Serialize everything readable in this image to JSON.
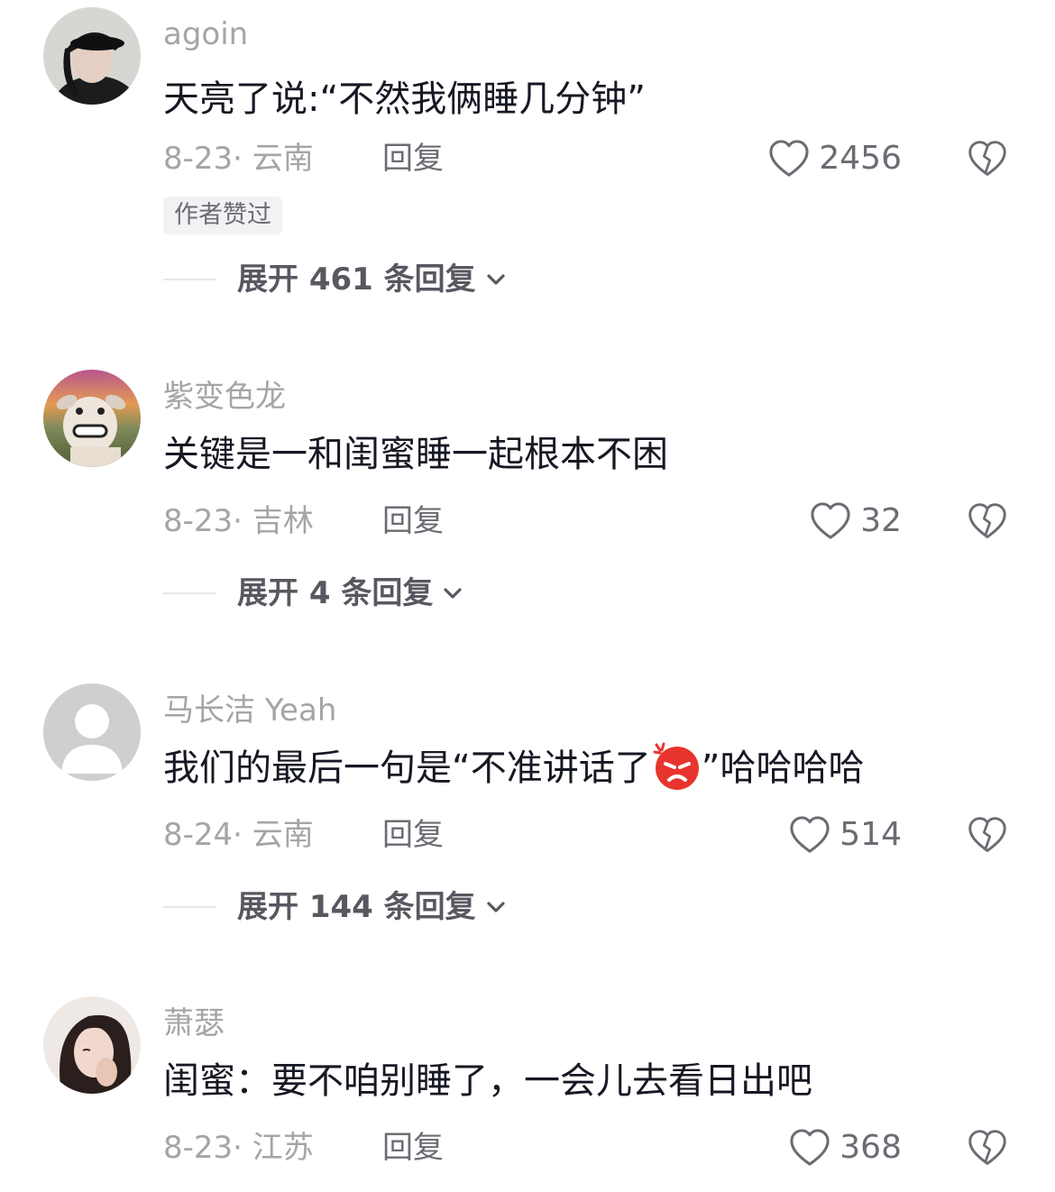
{
  "comments": [
    {
      "username": "agoin",
      "text": "天亮了说:“不然我俩睡几分钟”",
      "meta": "8-23· 云南",
      "reply": "回复",
      "likes": "2456",
      "badge": "作者赞过",
      "expand": "展开 461 条回复"
    },
    {
      "username": "紫变色龙",
      "text": "关键是一和闺蜜睡一起根本不困",
      "meta": "8-23· 吉林",
      "reply": "回复",
      "likes": "32",
      "expand": "展开 4 条回复"
    },
    {
      "username": "马长洁 Yeah",
      "text_before": "我们的最后一句是“不准讲话了",
      "text_after": "”哈哈哈哈",
      "meta": "8-24· 云南",
      "reply": "回复",
      "likes": "514",
      "expand": "展开 144 条回复"
    },
    {
      "username": "萧瑟",
      "text": "闺蜜：要不咱别睡了，一会儿去看日出吧",
      "meta": "8-23· 江苏",
      "reply": "回复",
      "likes": "368"
    }
  ],
  "icons": {
    "like": "heart-outline-icon",
    "dislike": "broken-heart-icon",
    "expand": "chevron-down-icon",
    "emoji": "angry-face-emoji"
  },
  "colors": {
    "text": "#161823",
    "muted": "#a5a5a8",
    "secondary": "#6b6c73",
    "expand": "#575860"
  }
}
